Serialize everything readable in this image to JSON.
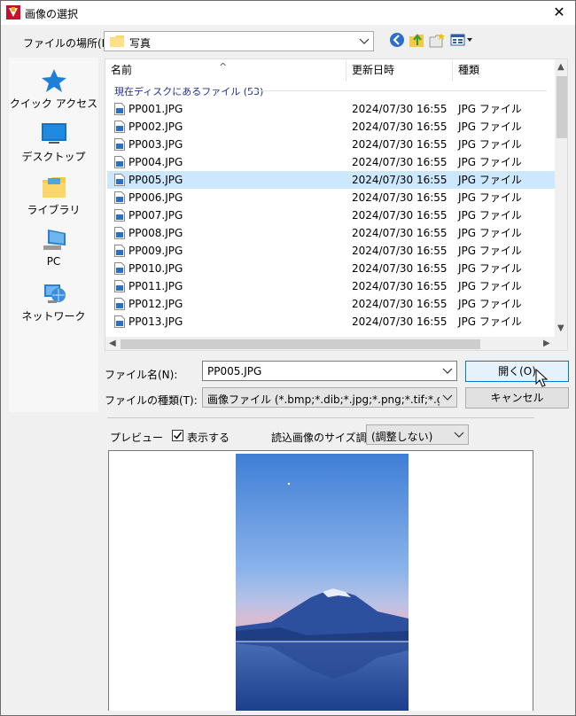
{
  "window": {
    "title": "画像の選択"
  },
  "lookin": {
    "label": "ファイルの場所(I):",
    "value": "写真"
  },
  "places": [
    {
      "label": "クイック アクセス",
      "icon": "star-icon"
    },
    {
      "label": "デスクトップ",
      "icon": "desktop-icon"
    },
    {
      "label": "ライブラリ",
      "icon": "library-folder-icon"
    },
    {
      "label": "PC",
      "icon": "computer-icon"
    },
    {
      "label": "ネットワーク",
      "icon": "network-icon"
    }
  ],
  "list": {
    "columns": [
      "名前",
      "更新日時",
      "種類"
    ],
    "group": "現在ディスクにあるファイル (53)",
    "rows": [
      {
        "name": "PP001.JPG",
        "date": "2024/07/30 16:55",
        "type": "JPG ファイル"
      },
      {
        "name": "PP002.JPG",
        "date": "2024/07/30 16:55",
        "type": "JPG ファイル"
      },
      {
        "name": "PP003.JPG",
        "date": "2024/07/30 16:55",
        "type": "JPG ファイル"
      },
      {
        "name": "PP004.JPG",
        "date": "2024/07/30 16:55",
        "type": "JPG ファイル"
      },
      {
        "name": "PP005.JPG",
        "date": "2024/07/30 16:55",
        "type": "JPG ファイル",
        "selected": true
      },
      {
        "name": "PP006.JPG",
        "date": "2024/07/30 16:55",
        "type": "JPG ファイル"
      },
      {
        "name": "PP007.JPG",
        "date": "2024/07/30 16:55",
        "type": "JPG ファイル"
      },
      {
        "name": "PP008.JPG",
        "date": "2024/07/30 16:55",
        "type": "JPG ファイル"
      },
      {
        "name": "PP009.JPG",
        "date": "2024/07/30 16:55",
        "type": "JPG ファイル"
      },
      {
        "name": "PP010.JPG",
        "date": "2024/07/30 16:55",
        "type": "JPG ファイル"
      },
      {
        "name": "PP011.JPG",
        "date": "2024/07/30 16:55",
        "type": "JPG ファイル"
      },
      {
        "name": "PP012.JPG",
        "date": "2024/07/30 16:55",
        "type": "JPG ファイル"
      },
      {
        "name": "PP013.JPG",
        "date": "2024/07/30 16:55",
        "type": "JPG ファイル"
      }
    ]
  },
  "filename": {
    "label": "ファイル名(N):",
    "value": "PP005.JPG"
  },
  "filetype": {
    "label": "ファイルの種類(T):",
    "value": "画像ファイル (*.bmp;*.dib;*.jpg;*.png;*.tif;*.gif;*.psd;"
  },
  "buttons": {
    "open": "開く(O)",
    "cancel": "キャンセル"
  },
  "preview": {
    "label": "プレビュー",
    "show_label": "表示する",
    "show_checked": true,
    "size_label": "読込画像のサイズ調",
    "size_value": "(調整しない)"
  },
  "colors": {
    "selection": "#cce8ff",
    "accent": "#0078d7",
    "group_text": "#1e3287"
  }
}
